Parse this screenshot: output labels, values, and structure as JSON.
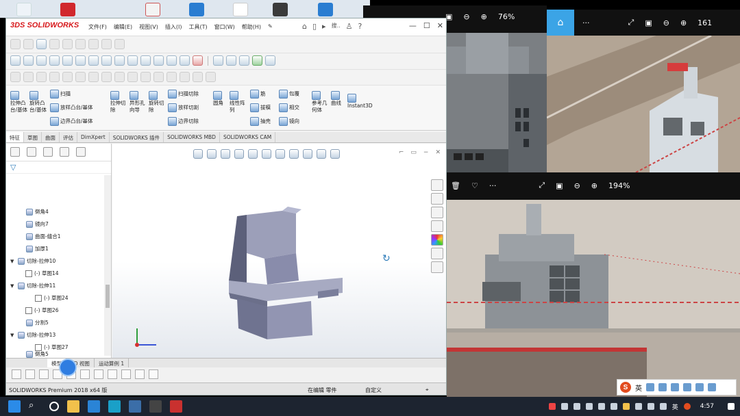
{
  "solidworks": {
    "logo": "3DS SOLIDWORKS",
    "menus": [
      "文件(F)",
      "编辑(E)",
      "视图(V)",
      "插入(I)",
      "工具(T)",
      "窗口(W)",
      "帮助(H)"
    ],
    "search_hint": "搜..",
    "help": "?",
    "ribbon": {
      "boss_extrude": "拉伸凸台/基体",
      "revolve_boss": "旋转凸台/基体",
      "sweep_boss": "扫描",
      "loft_boss": "放样凸台/基体",
      "boundary_boss": "边界凸台/基体",
      "extrude_cut": "拉伸切除",
      "hole_wizard": "异形孔向导",
      "revolve_cut": "旋转切除",
      "sweep_cut": "扫描切除",
      "loft_cut": "放样切割",
      "boundary_cut": "边界切除",
      "fillet": "圆角",
      "linear_pattern": "线性阵列",
      "rib": "筋",
      "wrap": "包覆",
      "draft": "拔模",
      "intersect": "相交",
      "shell": "抽壳",
      "mirror": "镜向",
      "reference_geometry": "参考几何体",
      "curves": "曲线",
      "instant3d": "Instant3D"
    },
    "tabs": [
      "特征",
      "草图",
      "曲面",
      "评估",
      "DimXpert",
      "SOLIDWORKS 插件",
      "SOLIDWORKS MBD",
      "SOLIDWORKS CAM"
    ],
    "tree": [
      {
        "label": "倒角4",
        "expand": ""
      },
      {
        "label": "镜向7",
        "expand": ""
      },
      {
        "label": "曲面-缝合1",
        "expand": ""
      },
      {
        "label": "加厚1",
        "expand": ""
      },
      {
        "label": "切除-拉伸10",
        "expand": "▼"
      },
      {
        "label": "(-) 草图14",
        "expand": ""
      },
      {
        "label": "切除-拉伸11",
        "expand": "▼"
      },
      {
        "label": "(-) 草图24",
        "expand": ""
      },
      {
        "label": "(-) 草图26",
        "expand": ""
      },
      {
        "label": "分割5",
        "expand": ""
      },
      {
        "label": "切除-拉伸13",
        "expand": "▼"
      },
      {
        "label": "(-) 草图27",
        "expand": ""
      },
      {
        "label": "倒角5",
        "expand": ""
      }
    ],
    "bottom_tabs": [
      "模型",
      "3D 视图",
      "运动算例 1"
    ],
    "status": {
      "product": "SOLIDWORKS Premium 2018 x64 版",
      "editing": "在编辑 零件",
      "units": "自定义"
    }
  },
  "viewer_top_left": {
    "zoom": "76%"
  },
  "viewer_top_right": {
    "zoom": "161"
  },
  "viewer_bottom": {
    "zoom": "194%"
  },
  "ime": {
    "logo": "S",
    "lang": "英"
  },
  "tray": {
    "lang": "英",
    "time": "4:57"
  }
}
